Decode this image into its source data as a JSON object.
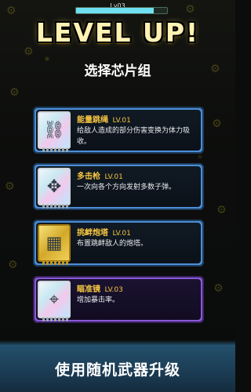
{
  "hud": {
    "level_label": "Lv03",
    "xp_progress": 0.85
  },
  "title": "LEVEL UP!",
  "subtitle": "选择芯片组",
  "cards": [
    {
      "name": "能量跳绳",
      "level": "LV.01",
      "desc": "给敌人造成的部分伤害变换为体力吸收。",
      "border": "#4b8fd6",
      "icon": "robot-arm-icon"
    },
    {
      "name": "多击枪",
      "level": "LV.01",
      "desc": "一次向各个方向发射多数子弹。",
      "border": "#4b8fd6",
      "icon": "multi-gun-icon"
    },
    {
      "name": "挑衅炮塔",
      "level": "LV.01",
      "desc": "布置跳衅敌人的炮塔。",
      "border": "#4b8fd6",
      "icon": "turret-icon"
    },
    {
      "name": "瞄准镜",
      "level": "LV.03",
      "desc": "增加暴击率。",
      "border": "#8a58d6",
      "icon": "scope-icon"
    }
  ],
  "banner": {
    "text": "使用随机武器升级"
  }
}
